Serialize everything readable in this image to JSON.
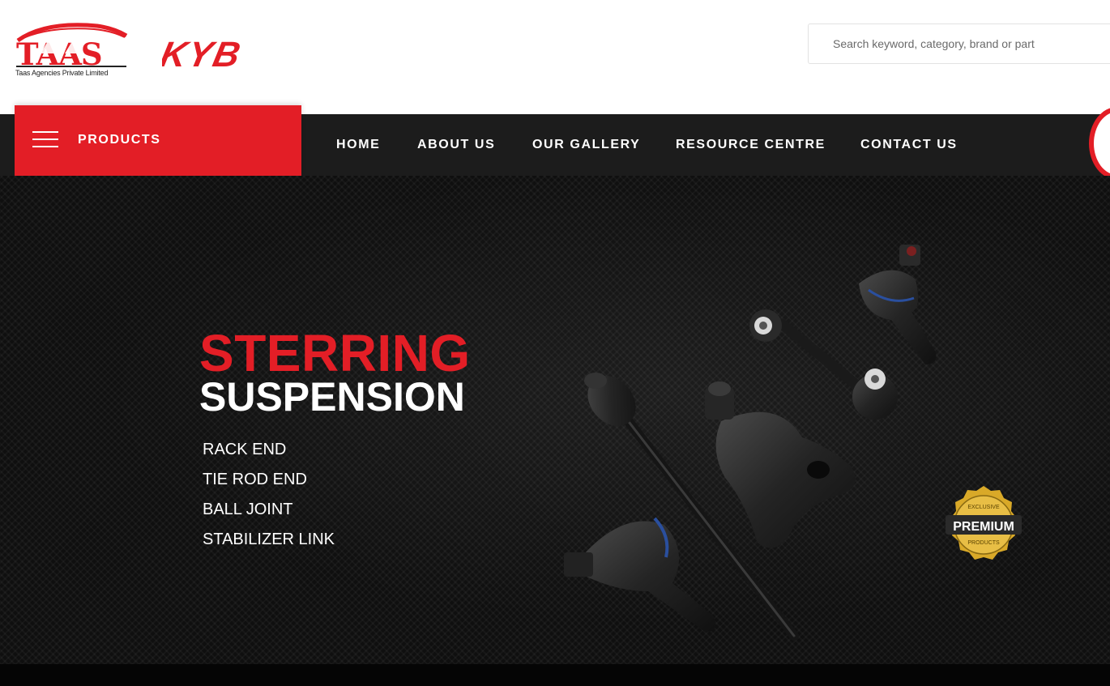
{
  "header": {
    "brand": {
      "name": "TAAS",
      "tagline": "Taas Agencies Private Limited"
    },
    "partner_brand": "KYB",
    "search": {
      "placeholder": "Search keyword, category, brand or part",
      "value": ""
    }
  },
  "nav": {
    "products_label": "PRODUCTS",
    "items": [
      {
        "label": "HOME"
      },
      {
        "label": "ABOUT US"
      },
      {
        "label": "OUR GALLERY"
      },
      {
        "label": "RESOURCE CENTRE"
      },
      {
        "label": "CONTACT US"
      }
    ]
  },
  "hero": {
    "heading_red": "STERRING",
    "heading_white": "SUSPENSION",
    "items": [
      "RACK END",
      "TIE ROD END",
      "BALL JOINT",
      "STABILIZER LINK"
    ],
    "badge": {
      "top": "EXCLUSIVE",
      "main": "PREMIUM",
      "bottom": "PRODUCTS"
    }
  },
  "colors": {
    "accent": "#e31e26",
    "nav_background": "#1c1c1c",
    "hero_background": "#0f0f0f",
    "badge_gold": "#d9a928"
  },
  "icons": [
    "hamburger-icon",
    "cart-icon"
  ]
}
